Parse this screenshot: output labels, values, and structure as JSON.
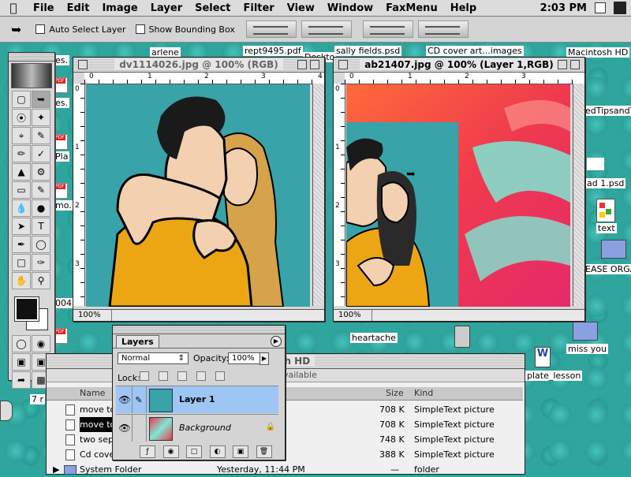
{
  "menubar": {
    "items": [
      "File",
      "Edit",
      "Image",
      "Layer",
      "Select",
      "Filter",
      "View",
      "Window",
      "FaxMenu",
      "Help"
    ],
    "clock": "2:03 PM"
  },
  "options": {
    "auto_select": "Auto Select Layer",
    "bounding_box": "Show Bounding Box"
  },
  "desktop": {
    "labels": [
      "rept9495.pdf",
      "arlene",
      "sally fields.psd",
      "CD cover art...images",
      "Macintosh HD",
      "edTipsandTr",
      "ad 1.psd",
      "text",
      "EASE ORGAN",
      "heartache",
      "miss you",
      "plate_lesson",
      "es.",
      "Pla",
      "mo.",
      "004",
      "7 r",
      "Doskto"
    ]
  },
  "window1": {
    "title": "dv1114026.jpg @ 100% (RGB)",
    "zoom": "100%",
    "ruler_h": [
      "0",
      "1",
      "2",
      "3",
      "4"
    ],
    "ruler_v": [
      "0",
      "1",
      "2",
      "3"
    ]
  },
  "window2": {
    "title": "ab21407.jpg @ 100% (Layer 1,RGB)",
    "zoom": "100%",
    "ruler_h": [
      "0",
      "1",
      "2",
      "3"
    ],
    "ruler_v": [
      "0",
      "1",
      "2",
      "3"
    ]
  },
  "layers": {
    "tab": "Layers",
    "blend_mode": "Normal",
    "opacity_label": "Opacity:",
    "opacity": "100%",
    "lock_label": "Lock:",
    "rows": [
      {
        "name": "Layer 1",
        "active": true
      },
      {
        "name": "Background",
        "active": false
      }
    ]
  },
  "finder": {
    "title": "ntosh HD",
    "info": "1 GB available",
    "col_name": "Name",
    "col_size": "Size",
    "col_kind": "Kind",
    "rows": [
      {
        "name": "move too",
        "size": "708 K",
        "kind": "SimpleText picture",
        "date": ""
      },
      {
        "name": "move too",
        "size": "708 K",
        "kind": "SimpleText picture",
        "date": ""
      },
      {
        "name": "two sepa",
        "size": "748 K",
        "kind": "SimpleText picture",
        "date": ""
      },
      {
        "name": "Cd cover",
        "size": "388 K",
        "kind": "SimpleText picture",
        "date": ""
      },
      {
        "name": "System Folder",
        "size": "—",
        "kind": "folder",
        "date": "Yesterday, 11:44 PM"
      }
    ]
  },
  "colors": {
    "teal_canvas": "#38a3a8",
    "shirt": "#eca613",
    "rose_red": "#ef3a4e",
    "rose_cyan": "#7ce8d4",
    "selected_layer": "#9ec6f4"
  }
}
